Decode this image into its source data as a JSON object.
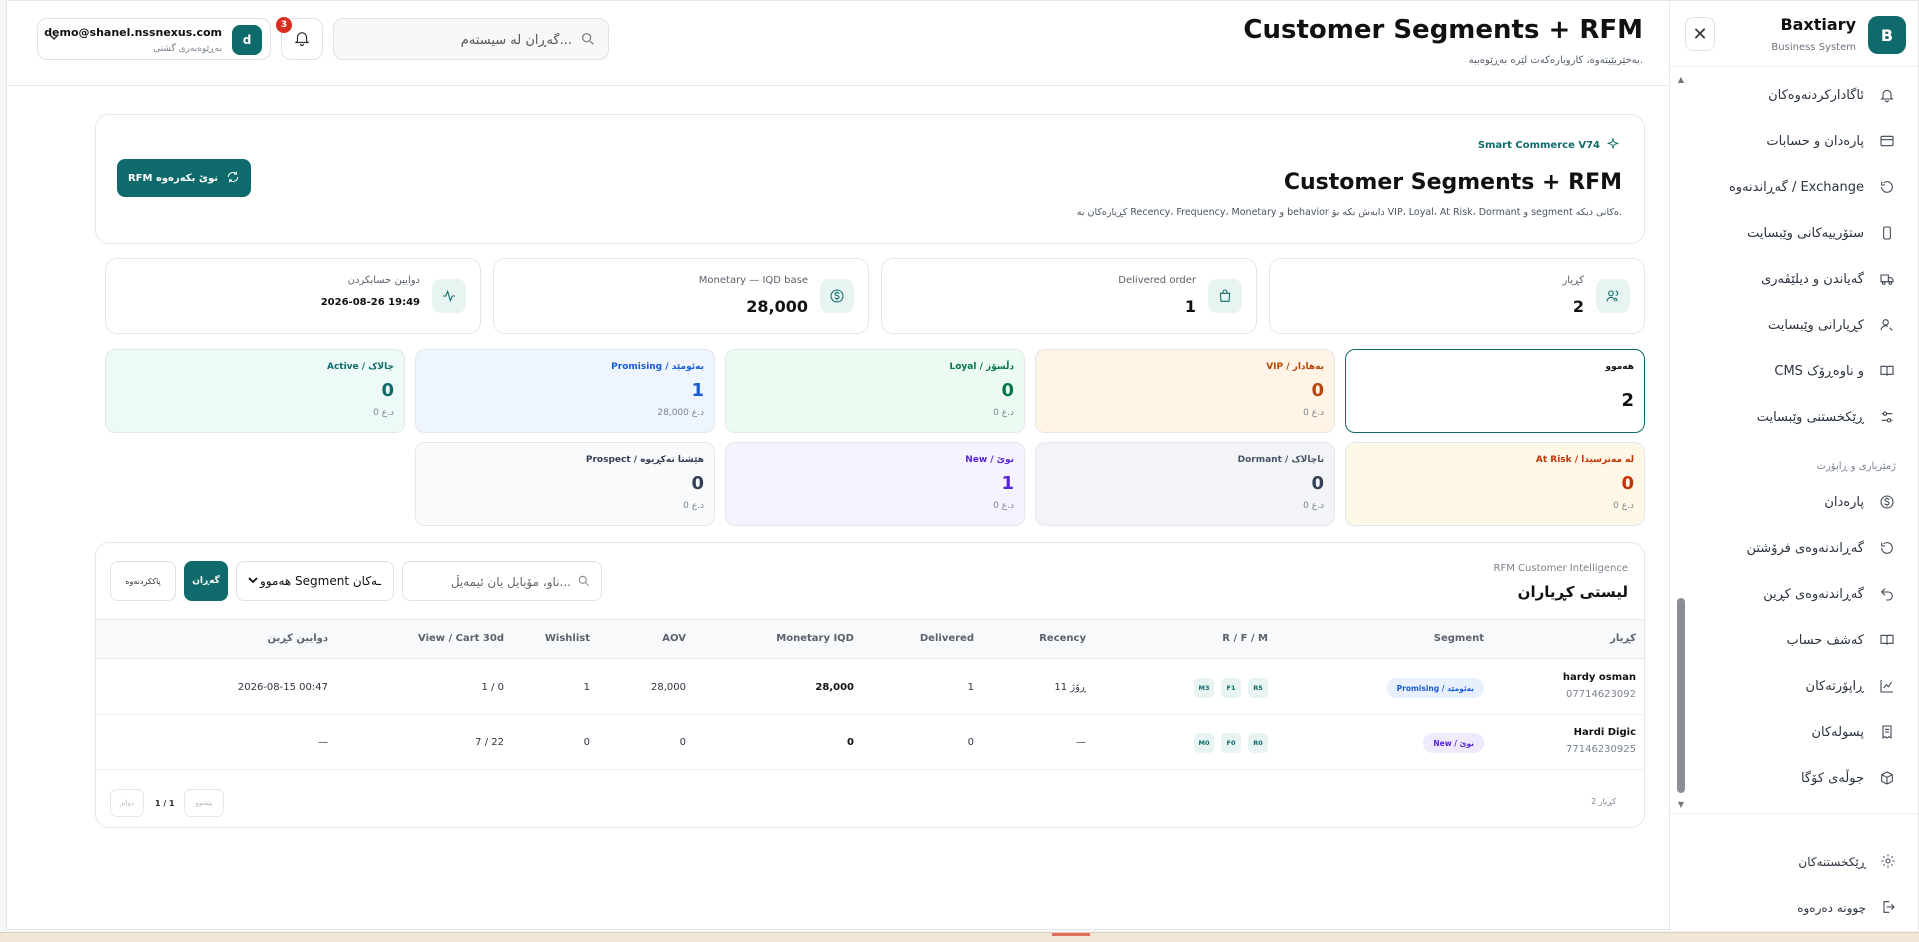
{
  "brand": {
    "initial": "B",
    "name": "Baxtiary",
    "subtitle": "Business System",
    "close": "✕"
  },
  "sidebar": {
    "items": [
      {
        "label": "ئاگادارکردنەوەکان",
        "icon": "bell-icon"
      },
      {
        "label": "پارەدان و حسابات",
        "icon": "wallet-icon"
      },
      {
        "label": "گەڕاندنەوە / Exchange",
        "icon": "rotate-icon"
      },
      {
        "label": "ستۆرییەکانی وێبسایت",
        "icon": "phone-icon"
      },
      {
        "label": "گەیاندن و دیلێڤەری",
        "icon": "truck-icon"
      },
      {
        "label": "کڕیارانی وێبسایت",
        "icon": "user-search-icon"
      },
      {
        "label": "CMS و ناوەڕۆک",
        "icon": "book-icon"
      },
      {
        "label": "ڕێکخستنی وێبسایت",
        "icon": "sliders-icon"
      }
    ],
    "section_label": "ژمێریاری و ڕاپۆرت",
    "items2": [
      {
        "label": "پارەدان",
        "icon": "dollar-icon"
      },
      {
        "label": "گەڕاندنەوەی فرۆشتن",
        "icon": "rotate-icon"
      },
      {
        "label": "گەڕاندنەوەی کڕین",
        "icon": "undo-icon"
      },
      {
        "label": "کەشف حساب",
        "icon": "book-icon"
      },
      {
        "label": "ڕاپۆرتەکان",
        "icon": "chart-icon"
      },
      {
        "label": "پسولەکان",
        "icon": "receipt-icon"
      },
      {
        "label": "جوڵەی کۆگا",
        "icon": "box-icon"
      }
    ],
    "footer": {
      "settings": "ڕێکخستنەکان",
      "logout": "چوونە دەرەوە"
    }
  },
  "header": {
    "title": "Customer Segments + RFM",
    "subtitle": "بەخێربێیتەوە، کاروبارەکەت لێرە بەڕێوەببە.",
    "search_placeholder": "گەڕان لە سیستەم...",
    "notification_count": "3",
    "user": {
      "initial": "d",
      "email": "demo@shanel.nssnexus.com",
      "role": "بەڕێوەبەری گشتی"
    }
  },
  "hero": {
    "kicker": "Smart Commerce V74",
    "title": "Customer Segments + RFM",
    "description": "کڕیارەکان بە Recency، Frequency، Monetary و behavior دابەش بکە بۆ VIP، Loyal، At Risk، Dormant و segment ەکانی دیکە.",
    "rebuild_button": "RFM نوێ بکەرەوە"
  },
  "stats": [
    {
      "label": "کڕیار",
      "value": "2",
      "icon": "users-icon"
    },
    {
      "label": "Delivered order",
      "value": "1",
      "icon": "bag-icon"
    },
    {
      "label": "Monetary — IQD base",
      "value": "28,000",
      "icon": "dollar-icon"
    },
    {
      "label": "دوایین حسابکردن",
      "value": "2026-08-26 19:49",
      "icon": "activity-icon"
    }
  ],
  "segments_row1": [
    {
      "name": "هەموو",
      "count": "2",
      "amount": ""
    },
    {
      "name": "VIP / بەهادار",
      "count": "0",
      "amount": "0 د.ع"
    },
    {
      "name": "Loyal / دڵسۆز",
      "count": "0",
      "amount": "0 د.ع"
    },
    {
      "name": "Promising / بەئومێد",
      "count": "1",
      "amount": "28,000 د.ع"
    },
    {
      "name": "Active / چالاک",
      "count": "0",
      "amount": "0 د.ع"
    }
  ],
  "segments_row2": [
    {
      "name": "At Risk / لە مەترسیدا",
      "count": "0",
      "amount": "0 د.ع"
    },
    {
      "name": "Dormant / ناچالاک",
      "count": "0",
      "amount": "0 د.ع"
    },
    {
      "name": "New / نوێ",
      "count": "1",
      "amount": "0 د.ع"
    },
    {
      "name": "Prospect / هێشتا نەکڕیوە",
      "count": "0",
      "amount": "0 د.ع"
    }
  ],
  "customers": {
    "kicker": "RFM Customer Intelligence",
    "title": "لیستی کڕیاران",
    "search_placeholder": "ناو، مۆبایل یان ئیمەیڵ...",
    "segment_select": "هەموو Segment ـەکان",
    "search_button": "گەڕان",
    "clear_button": "پاککردنەوە",
    "columns": {
      "customer": "کڕیار",
      "segment": "Segment",
      "rfm": "R / F / M",
      "recency": "Recency",
      "delivered": "Delivered",
      "monetary": "Monetary IQD",
      "aov": "AOV",
      "wishlist": "Wishlist",
      "view_cart": "View / Cart 30d",
      "last_purchase": "دوایین کڕین"
    },
    "rows": [
      {
        "name": "hardy osman",
        "phone": "07714623092",
        "segment": "Promising / بەئومێد",
        "r": "R5",
        "f": "F1",
        "m": "M3",
        "recency": "11 ڕۆژ",
        "delivered": "1",
        "monetary": "28,000",
        "aov": "28,000",
        "wishlist": "1",
        "view_cart": "1 / 0",
        "last_purchase": "2026-08-15 00:47"
      },
      {
        "name": "Hardi Digic",
        "phone": "77146230925",
        "segment": "New / نوێ",
        "r": "R0",
        "f": "F0",
        "m": "M0",
        "recency": "—",
        "delivered": "0",
        "monetary": "0",
        "aov": "0",
        "wishlist": "0",
        "view_cart": "7 / 22",
        "last_purchase": "—"
      }
    ],
    "footer_count": "2 کڕیار",
    "page": "1 / 1",
    "prev": "پێشوو",
    "next": "دواتر"
  },
  "colors": {
    "accent": "#0f6b6b",
    "badge": "#d92d20"
  }
}
